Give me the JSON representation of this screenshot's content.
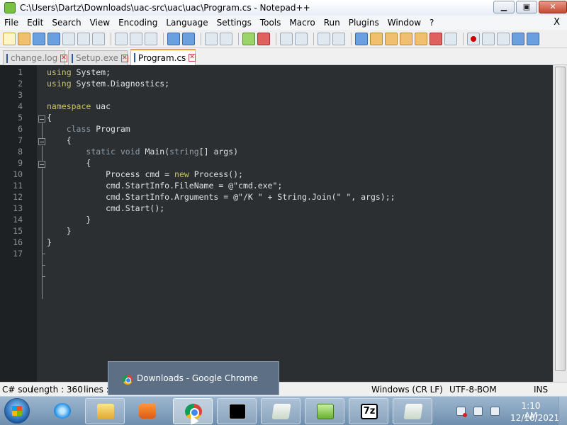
{
  "window": {
    "title": "C:\\Users\\Dartz\\Downloads\\uac-src\\uac\\uac\\Program.cs - Notepad++",
    "minimize_glyph": "▁",
    "maximize_glyph": "▣",
    "close_glyph": "✕"
  },
  "menubar": {
    "items": [
      "File",
      "Edit",
      "Search",
      "View",
      "Encoding",
      "Language",
      "Settings",
      "Tools",
      "Macro",
      "Run",
      "Plugins",
      "Window",
      "?"
    ],
    "close_glyph": "X"
  },
  "tabs": [
    {
      "label": "change.log",
      "active": false
    },
    {
      "label": "Setup.exe",
      "active": false
    },
    {
      "label": "Program.cs",
      "active": true
    }
  ],
  "tab_close_glyph": "✕",
  "editor": {
    "line_numbers": [
      "1",
      "2",
      "3",
      "4",
      "5",
      "6",
      "7",
      "8",
      "9",
      "10",
      "11",
      "12",
      "13",
      "14",
      "15",
      "16",
      "17"
    ],
    "lines": [
      [
        {
          "t": "using",
          "c": "kw"
        },
        {
          "t": " System;",
          "c": ""
        }
      ],
      [
        {
          "t": "using",
          "c": "kw"
        },
        {
          "t": " System.Diagnostics;",
          "c": ""
        }
      ],
      [],
      [
        {
          "t": "namespace",
          "c": "kw"
        },
        {
          "t": " uac",
          "c": ""
        }
      ],
      [
        {
          "t": "{",
          "c": ""
        }
      ],
      [
        {
          "t": "    ",
          "c": ""
        },
        {
          "t": "class",
          "c": "kw2"
        },
        {
          "t": " Program",
          "c": ""
        }
      ],
      [
        {
          "t": "    {",
          "c": ""
        }
      ],
      [
        {
          "t": "        ",
          "c": ""
        },
        {
          "t": "static",
          "c": "kw2"
        },
        {
          "t": " ",
          "c": ""
        },
        {
          "t": "void",
          "c": "kw2"
        },
        {
          "t": " Main(",
          "c": ""
        },
        {
          "t": "string",
          "c": "kw2"
        },
        {
          "t": "[] args)",
          "c": ""
        }
      ],
      [
        {
          "t": "        {",
          "c": ""
        }
      ],
      [
        {
          "t": "            Process cmd = ",
          "c": ""
        },
        {
          "t": "new",
          "c": "kw"
        },
        {
          "t": " Process();",
          "c": ""
        }
      ],
      [
        {
          "t": "            cmd.StartInfo.FileName = @\"cmd.exe\";",
          "c": ""
        }
      ],
      [
        {
          "t": "            cmd.StartInfo.Arguments = @\"/K \" + String.Join(\" \", args);;",
          "c": ""
        }
      ],
      [
        {
          "t": "            cmd.Start();",
          "c": ""
        }
      ],
      [
        {
          "t": "        }",
          "c": ""
        }
      ],
      [
        {
          "t": "    }",
          "c": ""
        }
      ],
      [
        {
          "t": "}",
          "c": ""
        }
      ],
      []
    ]
  },
  "statusbar": {
    "type": "C# sou",
    "length": "length : 360",
    "lines": "lines :",
    "eol": "Windows (CR LF)",
    "encoding": "UTF-8-BOM",
    "mode": "INS"
  },
  "popup": {
    "label": "Downloads - Google Chrome"
  },
  "taskbar": {
    "apps": [
      "internet-explorer",
      "file-explorer",
      "media-player",
      "google-chrome",
      "command-prompt",
      "notepad",
      "notepad-plus-plus",
      "7-zip",
      "notepad-2"
    ],
    "sevenzip_label": "7z",
    "clock_time": "1:10 AM",
    "clock_date": "12/16/2021"
  }
}
